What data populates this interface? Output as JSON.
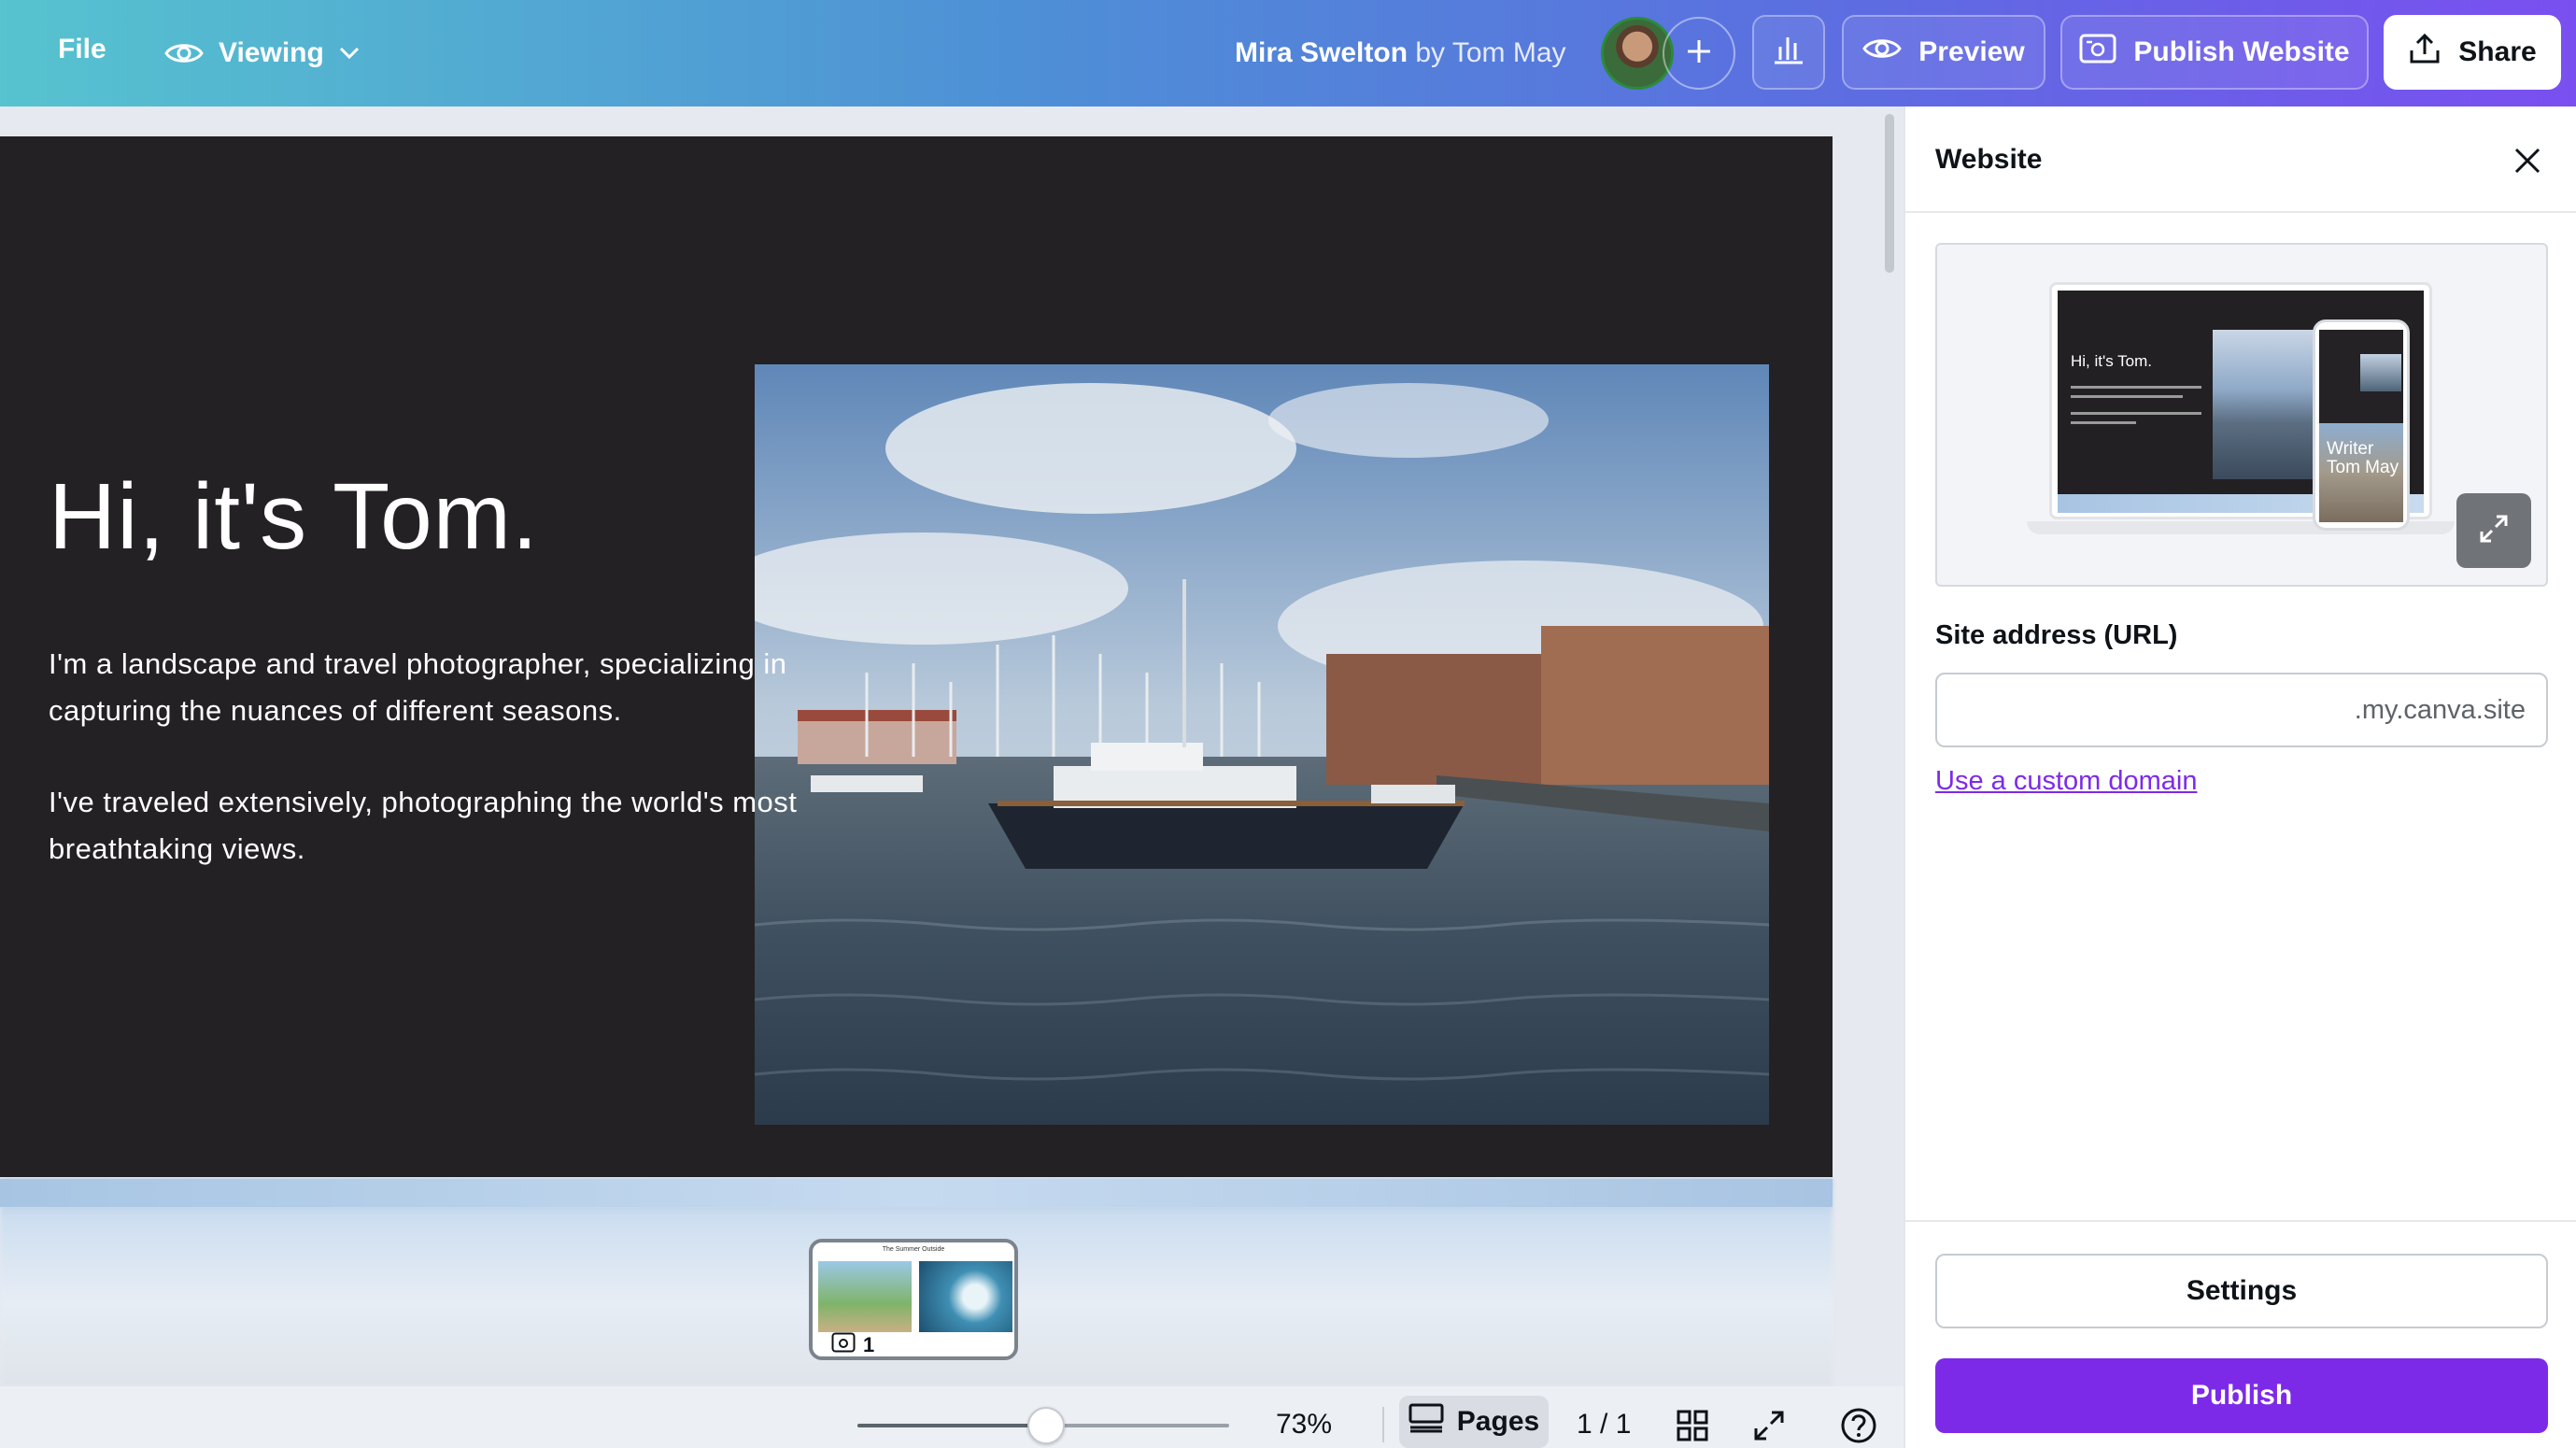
{
  "colors": {
    "accent": "#7d2ae8",
    "page_bg": "#232123",
    "topbar_start": "#56c3cf",
    "topbar_end": "#7a4ff0"
  },
  "topbar": {
    "file_label": "File",
    "viewing_label": "Viewing",
    "design_title": "Mira Swelton",
    "design_by": "by Tom May",
    "preview_label": "Preview",
    "publish_website_label": "Publish Website",
    "share_label": "Share",
    "icons": [
      "eye-icon",
      "chevron-down-icon",
      "plus-icon",
      "bar-chart-icon",
      "website-icon",
      "upload-icon"
    ]
  },
  "page": {
    "heading": "Hi, it's Tom.",
    "paragraph_1": "I'm a landscape and travel photographer, specializing in capturing the nuances of different seasons.",
    "paragraph_2": "I've traveled extensively, photographing the world's most breathtaking views."
  },
  "thumbnail": {
    "title": "The Summer Outside",
    "page_number": "1"
  },
  "bottombar": {
    "zoom": "73%",
    "zoom_value": 0.5,
    "pages_label": "Pages",
    "page_count": "1 / 1"
  },
  "panel": {
    "title": "Website",
    "preview": {
      "laptop_heading": "Hi, it's Tom.",
      "phone_text": "Writer Tom May"
    },
    "url_label": "Site address (URL)",
    "url_suffix": ".my.canva.site",
    "custom_domain_label": "Use a custom domain",
    "settings_label": "Settings",
    "publish_label": "Publish"
  }
}
